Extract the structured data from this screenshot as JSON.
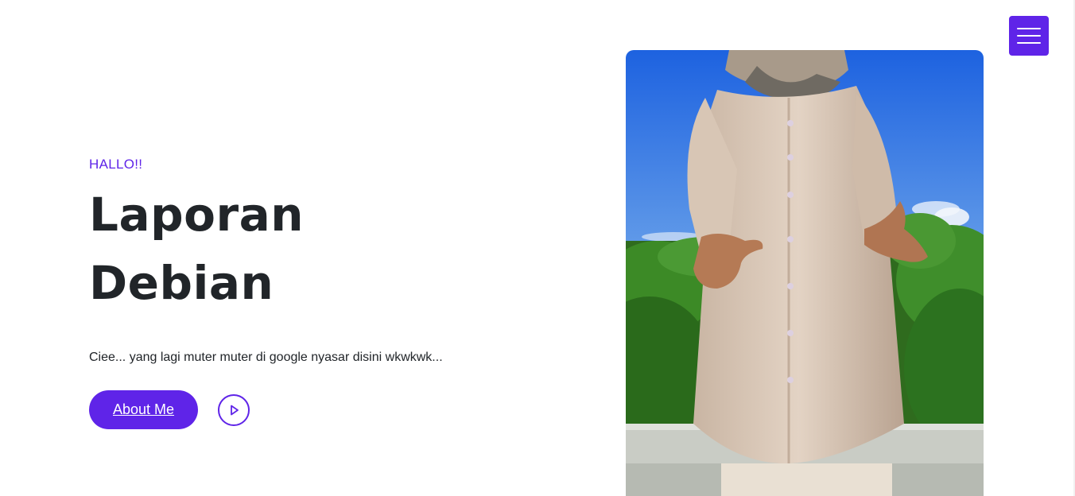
{
  "nav": {
    "menu_icon": "hamburger-icon",
    "accent_color": "#5f24e8"
  },
  "hero": {
    "eyebrow": "HALLO!!",
    "title_line1": "Laporan",
    "title_line2": "Debian",
    "subtitle": "Ciee... yang lagi muter muter di google nyasar disini wkwkwk...",
    "about_button": "About Me",
    "play_icon": "play-circle-icon"
  },
  "photo": {
    "icon": "photo-image"
  }
}
